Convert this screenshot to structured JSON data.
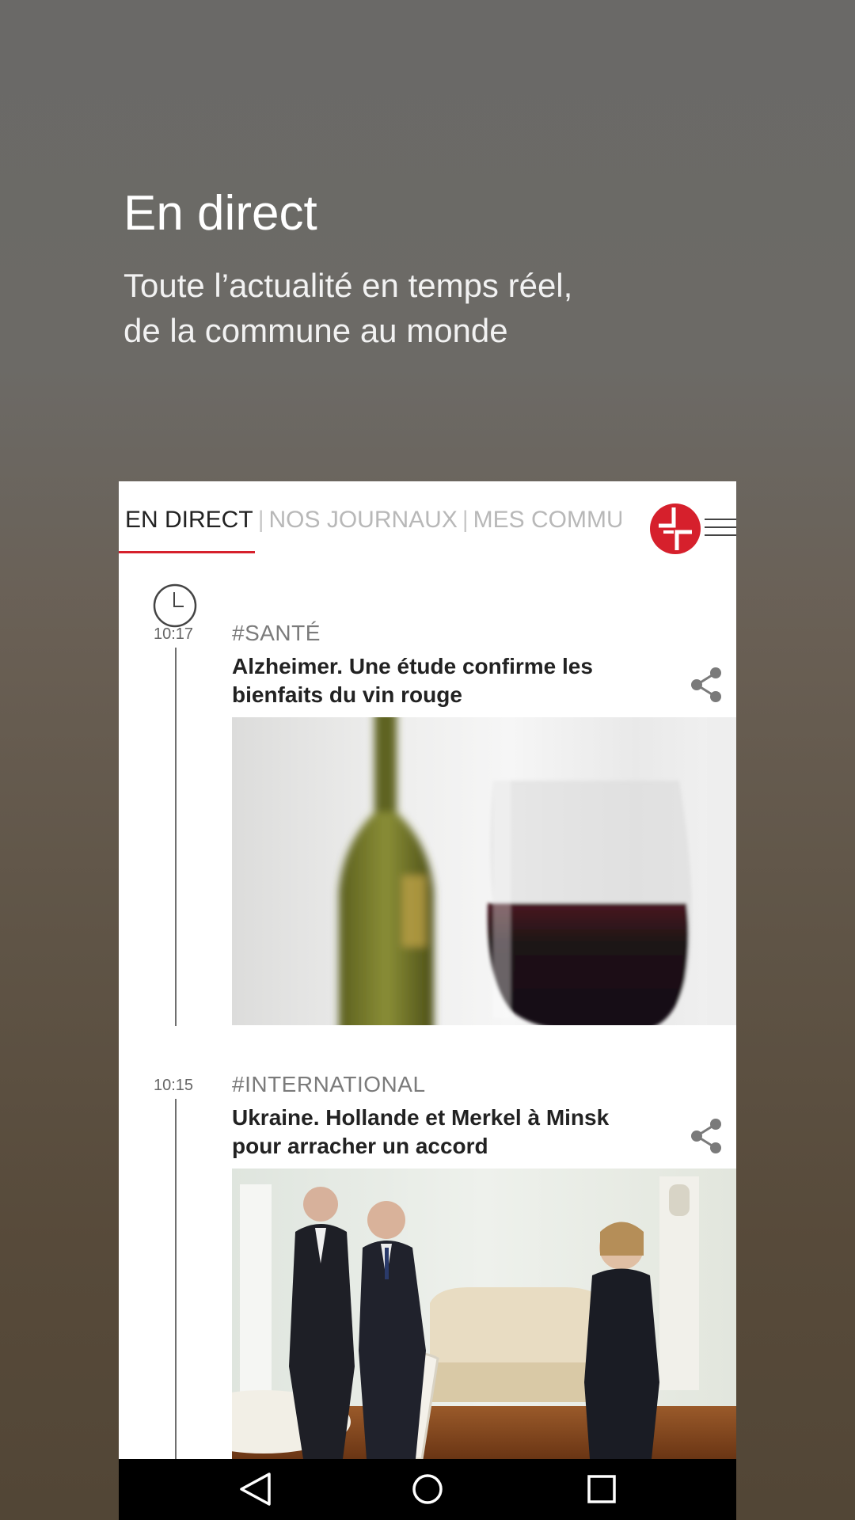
{
  "promo": {
    "title": "En direct",
    "subtitle": "Toute l’actualité en temps réel,\nde la commune au monde"
  },
  "tabs": [
    {
      "label": "EN DIRECT",
      "active": true
    },
    {
      "label": "NOS JOURNAUX",
      "active": false
    },
    {
      "label": "MES COMMU",
      "active": false
    }
  ],
  "colors": {
    "accent": "#d6202c",
    "headline": "#222222",
    "tag": "#7b7b7b",
    "navbar": "#000000"
  },
  "feed": {
    "articles": [
      {
        "time": "10:17",
        "tag": "#SANTÉ",
        "headline": "Alzheimer. Une étude confirme les bienfaits du vin rouge",
        "image": "wine-bottle-and-glass-photo"
      },
      {
        "time": "10:15",
        "tag": "#INTERNATIONAL",
        "headline": "Ukraine. Hollande et Merkel à Minsk pour arracher un accord",
        "image": "leaders-meeting-photo"
      }
    ]
  },
  "icons": {
    "logo": "ouest-france-logo-icon",
    "menu": "hamburger-menu-icon",
    "clock": "clock-icon",
    "share": "share-icon",
    "nav_back": "back-triangle-icon",
    "nav_home": "home-circle-icon",
    "nav_recents": "recents-square-icon"
  }
}
